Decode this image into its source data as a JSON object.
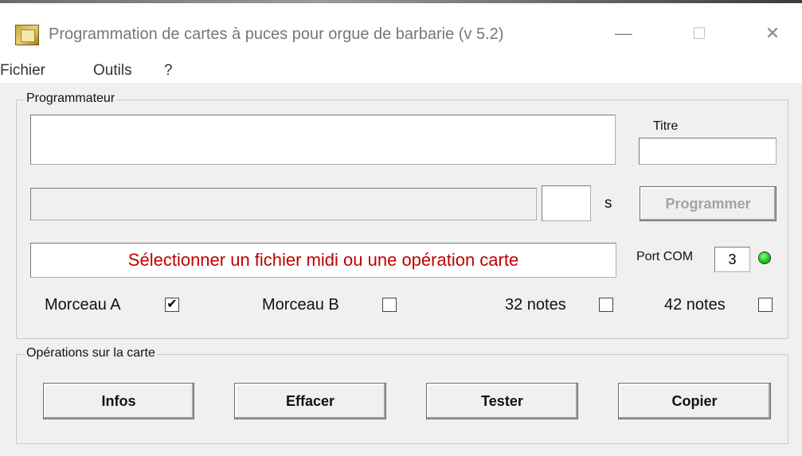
{
  "window": {
    "title": "Programmation de cartes à puces pour orgue de barbarie (v 5.2)",
    "controls": {
      "minimize": "—",
      "maximize": "☐",
      "close": "✕"
    }
  },
  "menu": {
    "items": [
      "Fichier",
      "Outils",
      "?"
    ]
  },
  "programmer": {
    "group_label": "Programmateur",
    "title_label": "Titre",
    "main_field_value": "",
    "title_field_value": "",
    "progress_value": "",
    "seconds_value": "",
    "seconds_unit": "s",
    "program_button": "Programmer",
    "status_message": "Sélectionner un fichier midi ou une opération carte",
    "status_color": "#c00000",
    "port_label": "Port COM",
    "port_value": "3",
    "led_color": "#19c419",
    "options": [
      {
        "label": "Morceau A",
        "checked": true
      },
      {
        "label": "Morceau B",
        "checked": false
      },
      {
        "label": "32 notes",
        "checked": false
      },
      {
        "label": "42 notes",
        "checked": false
      }
    ]
  },
  "card_ops": {
    "group_label": "Opérations sur la carte",
    "buttons": [
      "Infos",
      "Effacer",
      "Tester",
      "Copier"
    ]
  }
}
